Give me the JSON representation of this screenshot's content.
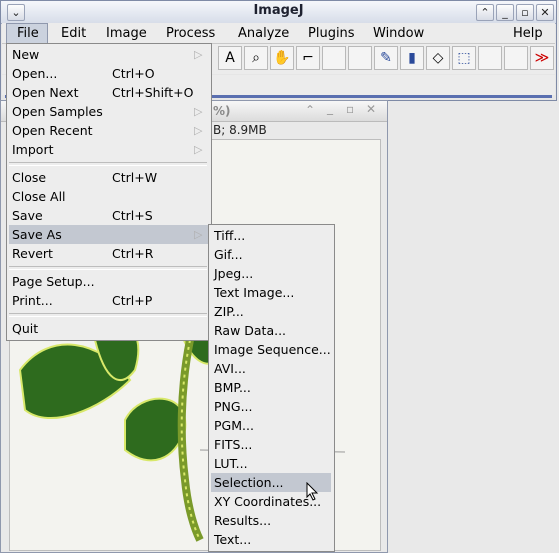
{
  "window": {
    "title": "ImageJ",
    "controls": [
      "v",
      "^",
      "_",
      "[]",
      "x"
    ]
  },
  "menubar": {
    "items": [
      "File",
      "Edit",
      "Image",
      "Process",
      "Analyze",
      "Plugins",
      "Window",
      "Help"
    ]
  },
  "toolbar": {
    "tools": [
      "text-icon",
      "magnifier-icon",
      "hand-icon",
      "dropper-icon",
      "pencil-icon",
      "brush-icon",
      "eraser-icon",
      "fill-icon",
      "more-icon"
    ],
    "tool_glyphs": [
      "A",
      "🔍",
      "✋",
      "⌐",
      "✎",
      "▮",
      "◇",
      "⬚",
      "≫"
    ]
  },
  "image_window": {
    "title_fragment": "%)",
    "subtitle": "B; 8.9MB"
  },
  "file_menu": {
    "items": [
      {
        "label": "New",
        "shortcut": "",
        "submenu": true
      },
      {
        "label": "Open...",
        "shortcut": "Ctrl+O",
        "submenu": false
      },
      {
        "label": "Open Next",
        "shortcut": "Ctrl+Shift+O",
        "submenu": false
      },
      {
        "label": "Open Samples",
        "shortcut": "",
        "submenu": true
      },
      {
        "label": "Open Recent",
        "shortcut": "",
        "submenu": true
      },
      {
        "label": "Import",
        "shortcut": "",
        "submenu": true
      },
      {
        "label": "Close",
        "shortcut": "Ctrl+W",
        "submenu": false
      },
      {
        "label": "Close All",
        "shortcut": "",
        "submenu": false
      },
      {
        "label": "Save",
        "shortcut": "Ctrl+S",
        "submenu": false
      },
      {
        "label": "Save As",
        "shortcut": "",
        "submenu": true
      },
      {
        "label": "Revert",
        "shortcut": "Ctrl+R",
        "submenu": false
      },
      {
        "label": "Page Setup...",
        "shortcut": "",
        "submenu": false
      },
      {
        "label": "Print...",
        "shortcut": "Ctrl+P",
        "submenu": false
      },
      {
        "label": "Quit",
        "shortcut": "",
        "submenu": false
      }
    ],
    "highlighted": "Save As"
  },
  "save_as_menu": {
    "items": [
      "Tiff...",
      "Gif...",
      "Jpeg...",
      "Text Image...",
      "ZIP...",
      "Raw Data...",
      "Image Sequence...",
      "AVI...",
      "BMP...",
      "PNG...",
      "PGM...",
      "FITS...",
      "LUT...",
      "Selection...",
      "XY Coordinates...",
      "Results...",
      "Text..."
    ],
    "highlighted": "Selection..."
  }
}
